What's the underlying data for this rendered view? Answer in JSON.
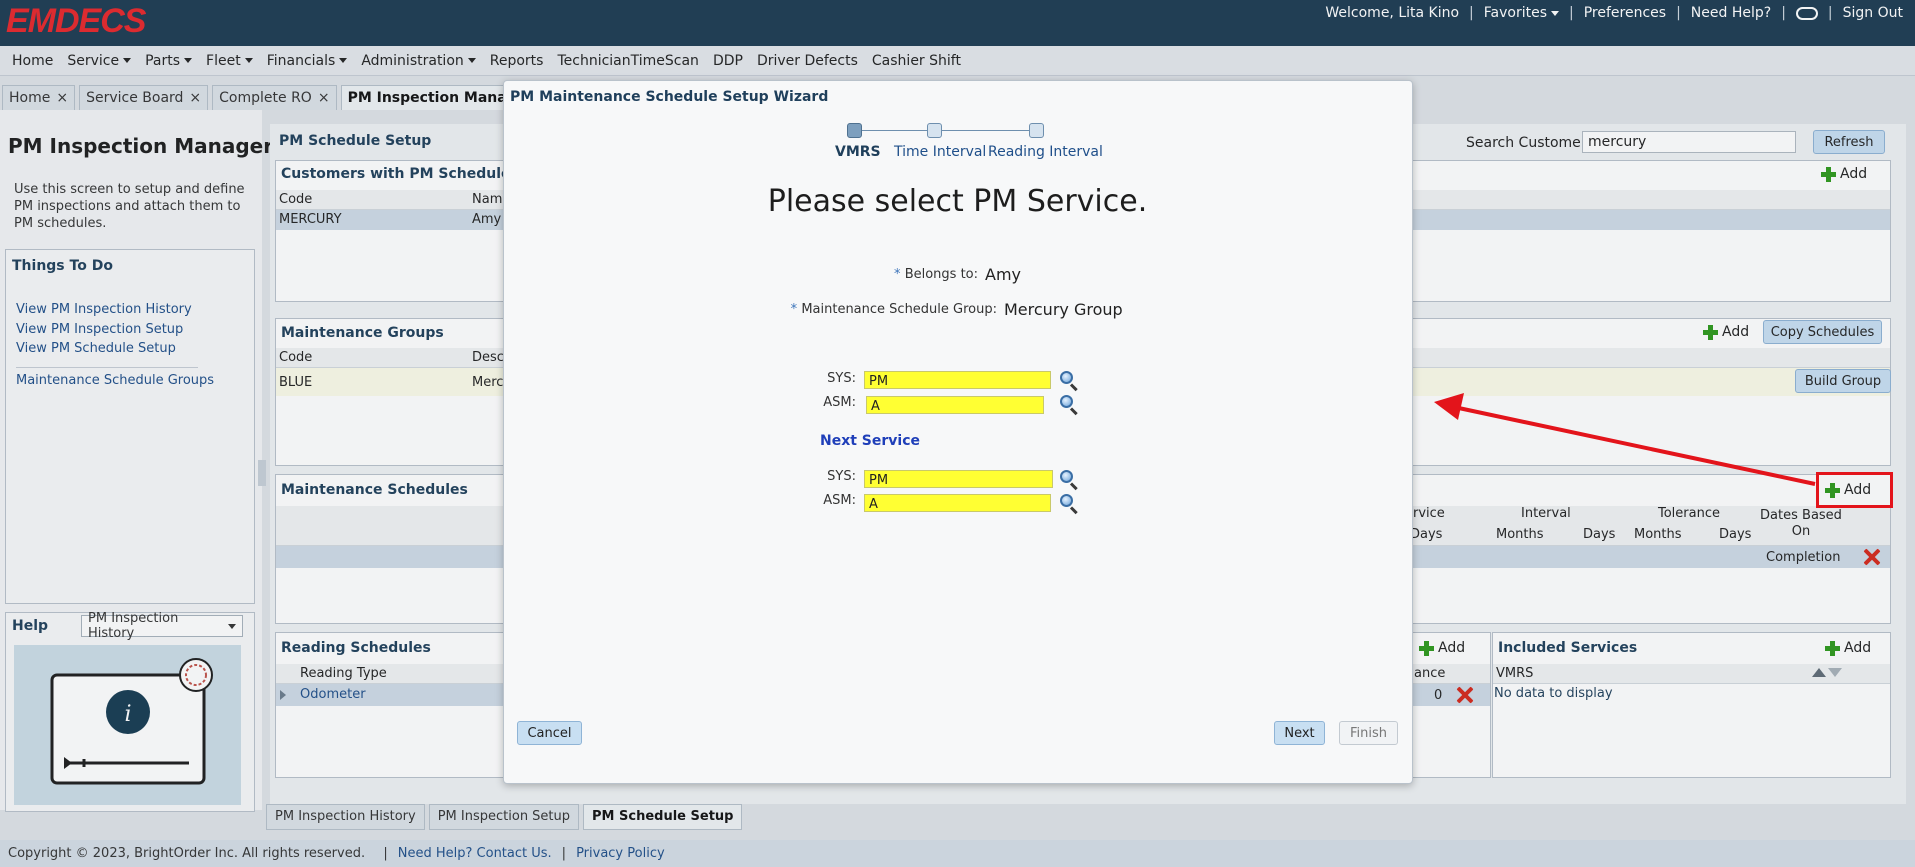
{
  "app": {
    "logo": "EMDECS",
    "top_links": {
      "welcome": "Welcome, Lita Kino",
      "favorites": "Favorites",
      "preferences": "Preferences",
      "help": "Need Help?",
      "sign_out": "Sign Out"
    },
    "menu": [
      "Home",
      "Service",
      "Parts",
      "Fleet",
      "Financials",
      "Administration",
      "Reports",
      "TechnicianTimeScan",
      "DDP",
      "Driver Defects",
      "Cashier Shift"
    ],
    "menu_dropdowns": [
      false,
      true,
      true,
      true,
      true,
      true,
      false,
      false,
      false,
      false,
      false
    ],
    "tabs": [
      {
        "label": "Home",
        "active": false
      },
      {
        "label": "Service Board",
        "active": false
      },
      {
        "label": "Complete RO",
        "active": false
      },
      {
        "label": "PM Inspection Manager",
        "active": true
      }
    ]
  },
  "left": {
    "title": "PM Inspection Manager",
    "description": "Use this screen to setup and define PM inspections and attach them to PM schedules.",
    "todo_title": "Things To Do",
    "todo_links": [
      "View PM Inspection History",
      "View PM Inspection Setup",
      "View PM Schedule Setup",
      "Maintenance Schedule Groups"
    ],
    "help_title": "Help",
    "help_select": "PM Inspection History"
  },
  "main": {
    "schedule_setup_title": "PM Schedule Setup",
    "search_label": "Search Customer:",
    "search_value": "mercury",
    "refresh": "Refresh",
    "customers": {
      "title": "Customers with PM Schedules",
      "add": "Add",
      "headers": [
        "Code",
        "Name"
      ],
      "row": [
        "MERCURY",
        "Amy"
      ]
    },
    "groups": {
      "title": "Maintenance Groups",
      "add": "Add",
      "copy": "Copy Schedules",
      "headers": [
        "Code",
        "Desc"
      ],
      "row": [
        "BLUE",
        "Merc"
      ],
      "build": "Build Group"
    },
    "schedules": {
      "title": "Maintenance Schedules",
      "add": "Add",
      "head_service": "rvice",
      "head_interval": "Interval",
      "head_tolerance": "Tolerance",
      "head_dates": "Dates Based On",
      "sub_days1": "Days",
      "sub_months1": "Months",
      "sub_days2": "Days",
      "sub_months2": "Months",
      "sub_days3": "Days",
      "row_value": "Completion"
    },
    "reading": {
      "title": "Reading Schedules",
      "add": "Add",
      "header": "Reading Type",
      "row": "Odometer",
      "tail_head": "ance",
      "tail_val": "0"
    },
    "included": {
      "title": "Included Services",
      "add": "Add",
      "header": "VMRS",
      "empty": "No data to display"
    }
  },
  "wizard": {
    "title": "PM Maintenance Schedule Setup Wizard",
    "steps": [
      {
        "label": "VMRS",
        "active": true
      },
      {
        "label": "Time Interval",
        "active": false
      },
      {
        "label": "Reading Interval",
        "active": false
      }
    ],
    "heading": "Please select PM Service.",
    "belongs_label": "Belongs to:",
    "belongs_value": "Amy",
    "group_label": "Maintenance Schedule Group:",
    "group_value": "Mercury Group",
    "sys_label": "SYS:",
    "sys_value": "PM",
    "asm_label": "ASM:",
    "asm_value": "A",
    "next_service": "Next Service",
    "next_sys_label": "SYS:",
    "next_sys_value": "PM",
    "next_asm_label": "ASM:",
    "next_asm_value": "A",
    "cancel": "Cancel",
    "next": "Next",
    "finish": "Finish"
  },
  "bottom_tabs": [
    {
      "label": "PM Inspection History",
      "active": false
    },
    {
      "label": "PM Inspection Setup",
      "active": false
    },
    {
      "label": "PM Schedule Setup",
      "active": true
    }
  ],
  "footer": {
    "copyright": "Copyright © 2023, BrightOrder Inc. All rights reserved.",
    "help": "Need Help? Contact Us.",
    "privacy": "Privacy Policy"
  },
  "colors": {
    "topbar": "#1d3b52",
    "logo": "#e8262b",
    "highlight_input": "#ffff33",
    "annotation": "#e3141b",
    "add_green": "#2e9a1c"
  }
}
